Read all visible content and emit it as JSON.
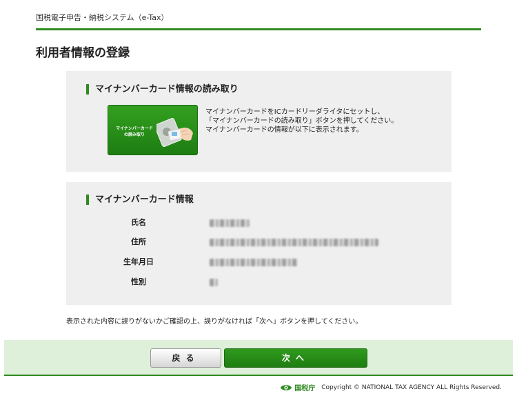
{
  "header": {
    "app_title": "国税電子申告・納税システム（e-Tax）",
    "page_title": "利用者情報の登録"
  },
  "read_section": {
    "heading": "マイナンバーカード情報の読み取り",
    "button_label_line1": "マイナンバーカード",
    "button_label_line2": "の読み取り",
    "button_icon": "card-reader-icon",
    "instructions": [
      "マイナンバーカードをICカードリーダライタにセットし、",
      "「マイナンバーカードの読み取り」ボタンを押してください。",
      "マイナンバーカードの情報が以下に表示されます。"
    ]
  },
  "info_section": {
    "heading": "マイナンバーカード情報",
    "rows": [
      {
        "label": "氏名",
        "value_state": "blurred"
      },
      {
        "label": "住所",
        "value_state": "blurred"
      },
      {
        "label": "生年月日",
        "value_state": "blurred"
      },
      {
        "label": "性別",
        "value_state": "blurred"
      }
    ]
  },
  "confirm_note": "表示された内容に誤りがないかご確認の上、誤りがなければ「次へ」ボタンを押してください。",
  "actions": {
    "back_label": "戻る",
    "next_label": "次へ"
  },
  "footer": {
    "logo_text": "国税庁",
    "copyright": "Copyright © NATIONAL TAX AGENCY ALL Rights Reserved."
  },
  "colors": {
    "brand_green": "#2e8b1f",
    "panel_gray": "#efefef",
    "action_bar_bg": "#dff0da"
  }
}
